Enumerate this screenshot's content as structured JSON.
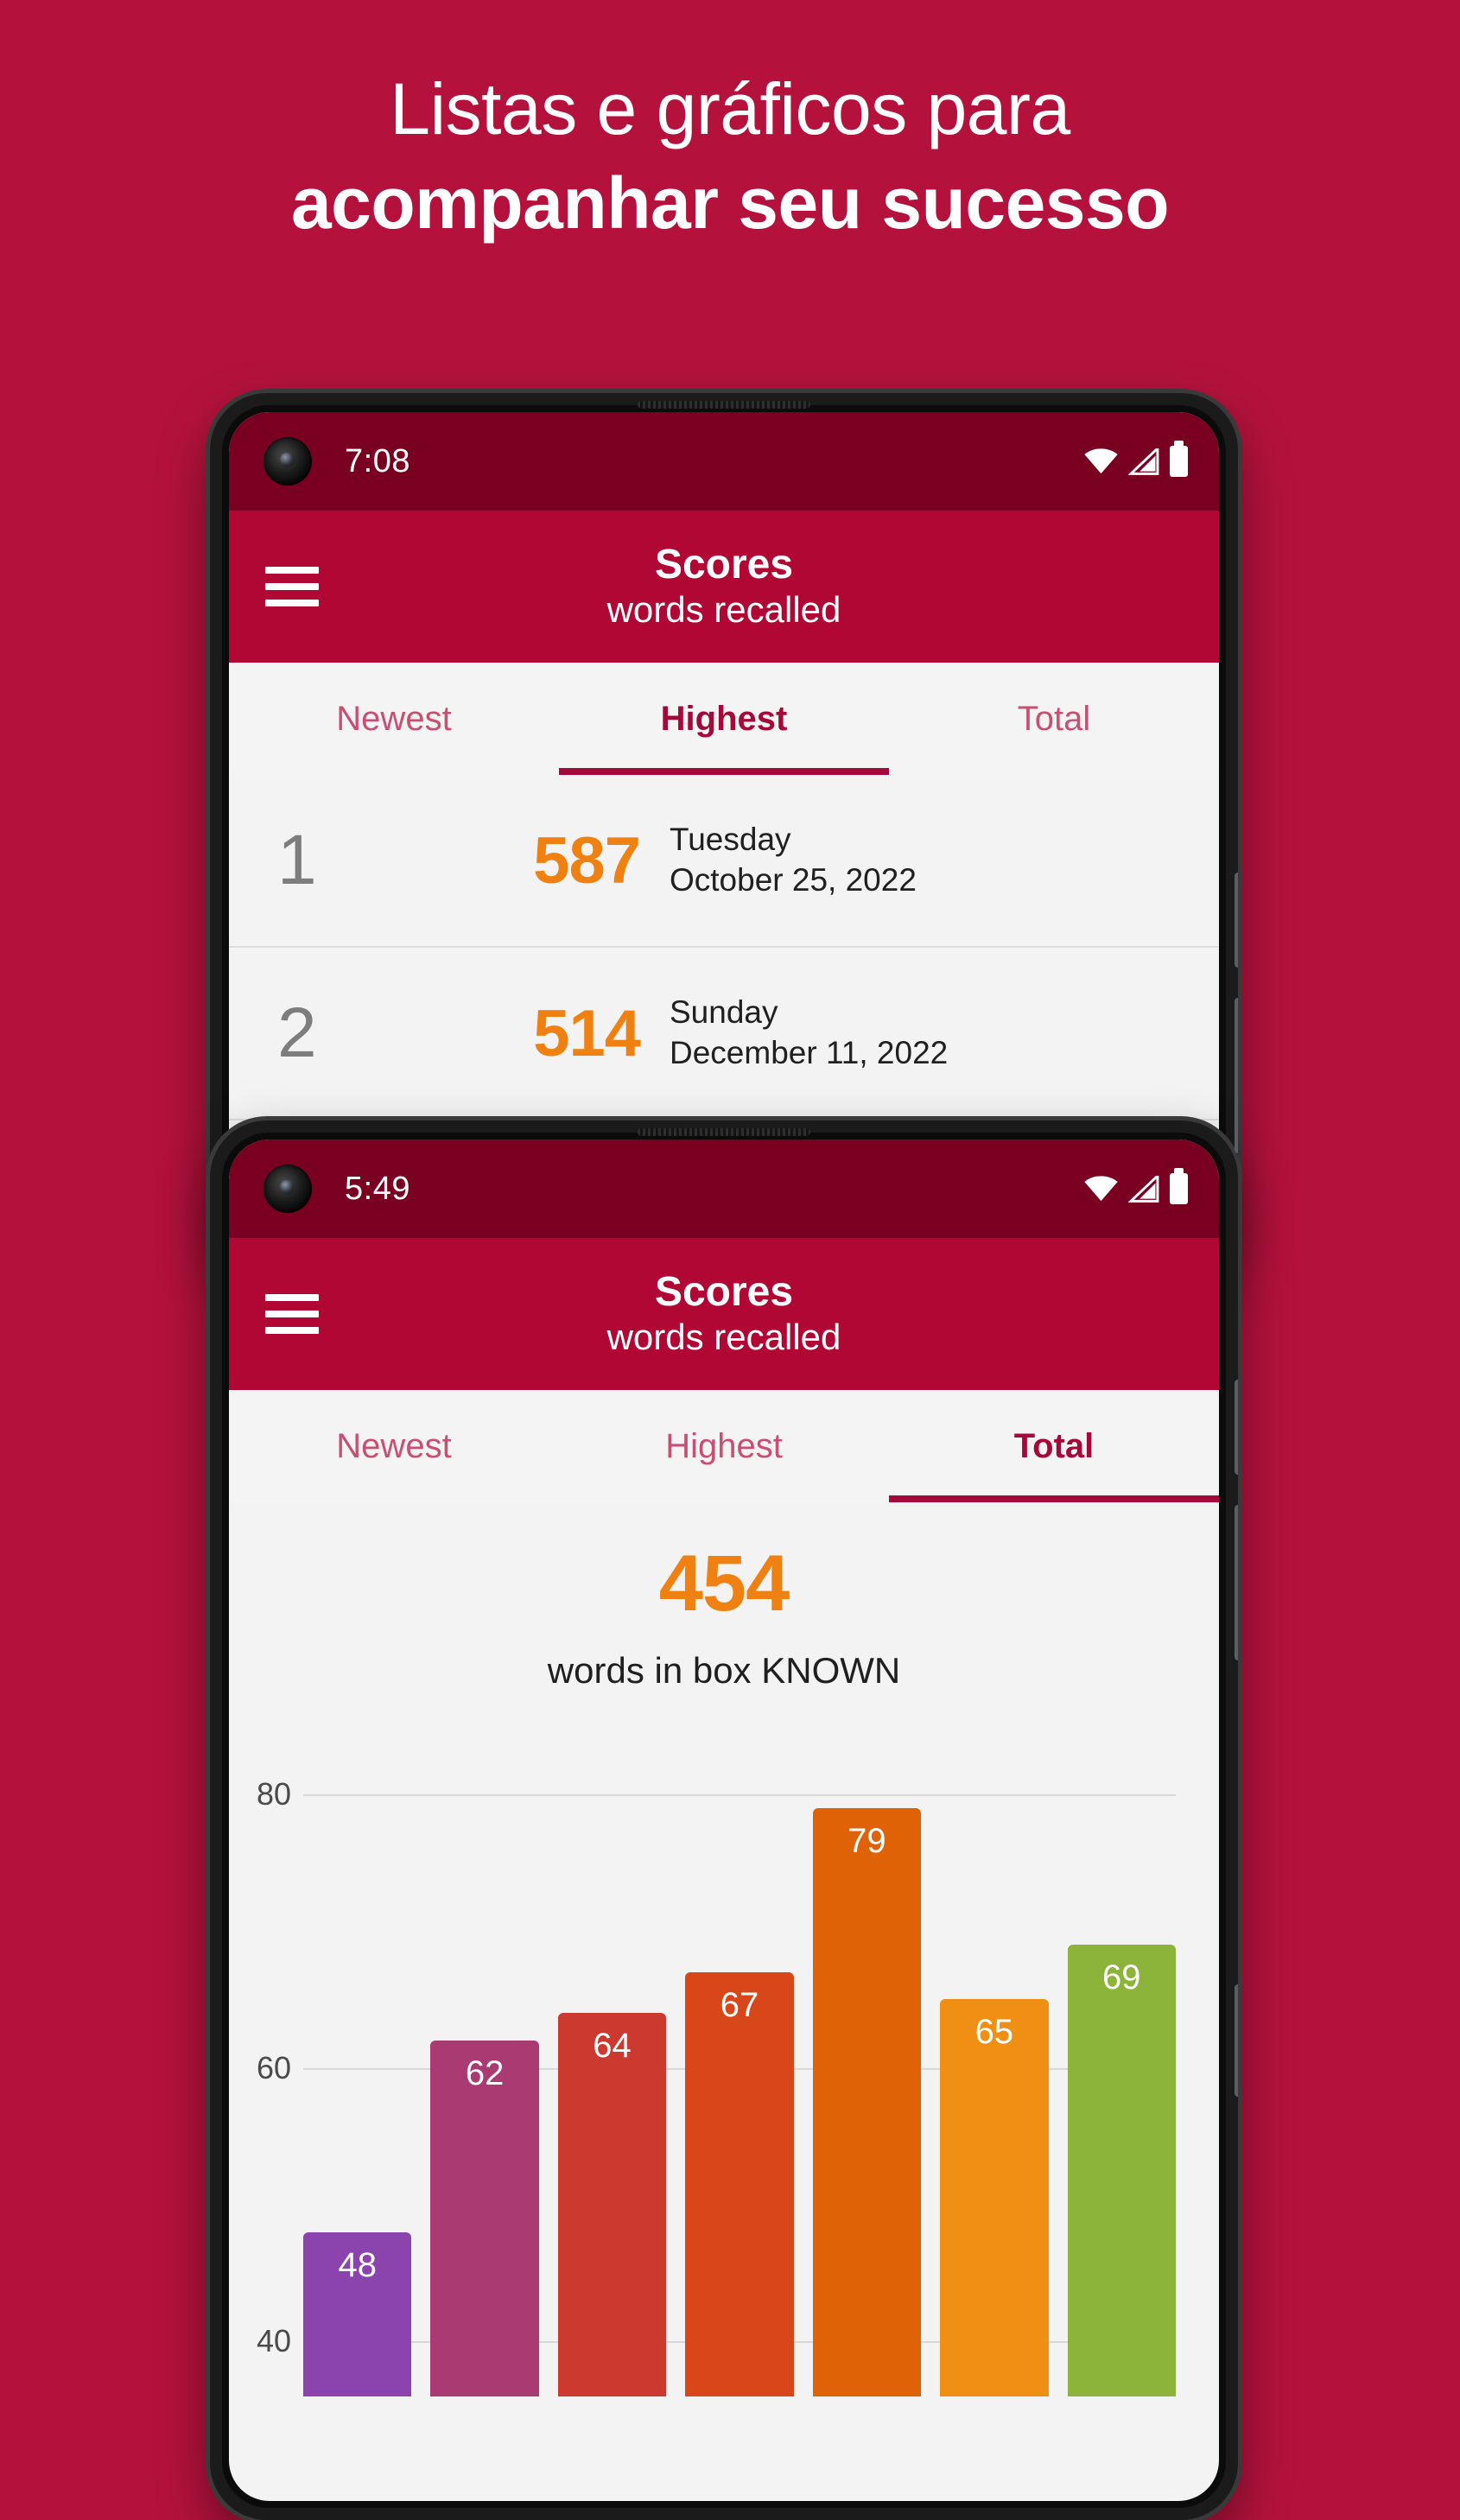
{
  "headline": {
    "line1": "Listas e gráficos para",
    "line2": "acompanhar seu sucesso"
  },
  "colors": {
    "background": "#b4123c",
    "statusbar": "#7a0022",
    "appbar": "#b00734",
    "accent_orange": "#ef8112",
    "tab_active": "#a3093a",
    "tab_inactive": "#c94f72"
  },
  "phone_top": {
    "status": {
      "time": "7:08",
      "icons": [
        "wifi-icon",
        "signal-icon",
        "battery-icon"
      ]
    },
    "appbar": {
      "menu_icon": "hamburger-menu-icon",
      "title": "Scores",
      "subtitle": "words recalled"
    },
    "tabs": [
      {
        "label": "Newest",
        "active": false
      },
      {
        "label": "Highest",
        "active": true
      },
      {
        "label": "Total",
        "active": false
      }
    ],
    "scores": [
      {
        "rank": "1",
        "score": "587",
        "weekday": "Tuesday",
        "date": "October 25, 2022"
      },
      {
        "rank": "2",
        "score": "514",
        "weekday": "Sunday",
        "date": "December 11, 2022"
      }
    ]
  },
  "phone_bottom": {
    "status": {
      "time": "5:49",
      "icons": [
        "wifi-icon",
        "signal-icon",
        "battery-icon"
      ]
    },
    "appbar": {
      "menu_icon": "hamburger-menu-icon",
      "title": "Scores",
      "subtitle": "words recalled"
    },
    "tabs": [
      {
        "label": "Newest",
        "active": false
      },
      {
        "label": "Highest",
        "active": false
      },
      {
        "label": "Total",
        "active": true
      }
    ],
    "total": {
      "value": "454",
      "caption": "words in box KNOWN"
    }
  },
  "chart_data": {
    "type": "bar",
    "title": "",
    "xlabel": "",
    "ylabel": "",
    "ylim": [
      36,
      84
    ],
    "yticks": [
      40,
      60,
      80
    ],
    "ytick_labels": [
      "40",
      "60",
      "80"
    ],
    "grid": true,
    "legend": "none",
    "categories": [
      "",
      "",
      "",
      "",
      "",
      "",
      ""
    ],
    "values": [
      48,
      62,
      64,
      67,
      79,
      65,
      69
    ],
    "bar_labels": [
      "48",
      "62",
      "64",
      "67",
      "79",
      "65",
      "69"
    ],
    "bar_colors": [
      "#8b44ad",
      "#a93b72",
      "#cc392f",
      "#d8471a",
      "#e06207",
      "#ef8f13",
      "#8cb33a"
    ]
  }
}
